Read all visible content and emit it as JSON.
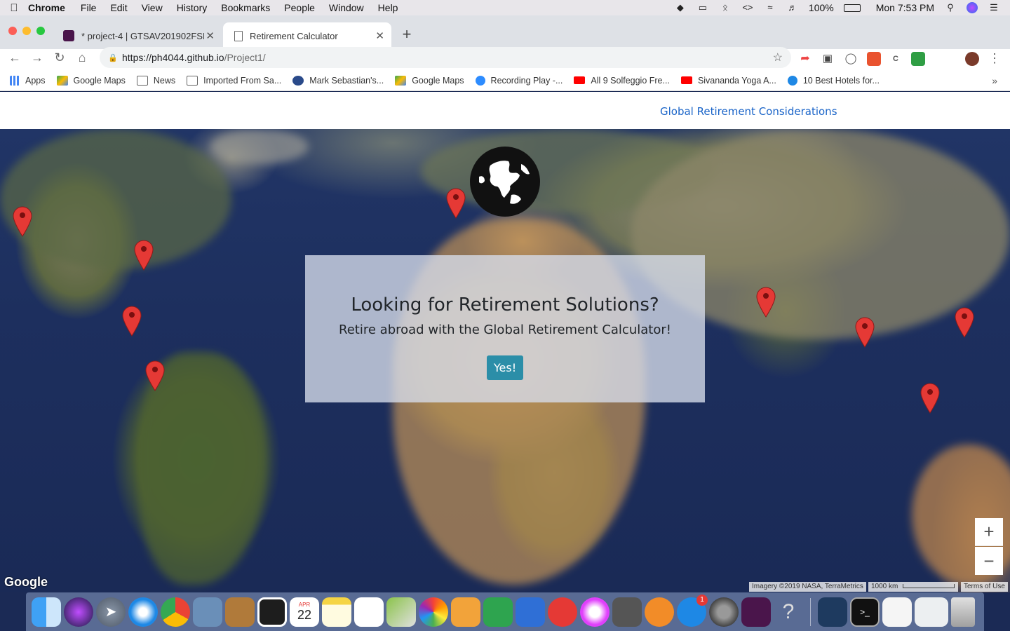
{
  "menubar": {
    "app": "Chrome",
    "items": [
      "File",
      "Edit",
      "View",
      "History",
      "Bookmarks",
      "People",
      "Window",
      "Help"
    ],
    "battery": "100%",
    "clock": "Mon 7:53 PM"
  },
  "tabs": [
    {
      "label": "* project-4 | GTSAV201902FSF",
      "active": false
    },
    {
      "label": "Retirement Calculator",
      "active": true
    }
  ],
  "address": {
    "host": "https://ph4044.github.io",
    "path": "/Project1/"
  },
  "bookmarks": [
    {
      "label": "Apps",
      "icon": "apps-grid-icon",
      "color": "#4285f4"
    },
    {
      "label": "Google Maps",
      "icon": "google-maps-icon",
      "color": "#34a853"
    },
    {
      "label": "News",
      "icon": "folder-icon",
      "color": "#777777"
    },
    {
      "label": "Imported From Sa...",
      "icon": "folder-icon",
      "color": "#777777"
    },
    {
      "label": "Mark Sebastian's...",
      "icon": "site-icon",
      "color": "#2a4a8a"
    },
    {
      "label": "Google Maps",
      "icon": "google-maps-icon",
      "color": "#34a853"
    },
    {
      "label": "Recording Play -...",
      "icon": "zoom-icon",
      "color": "#2d8cff"
    },
    {
      "label": "All 9 Solfeggio Fre...",
      "icon": "youtube-icon",
      "color": "#ff0000"
    },
    {
      "label": "Sivananda Yoga A...",
      "icon": "youtube-icon",
      "color": "#ff0000"
    },
    {
      "label": "10 Best Hotels for...",
      "icon": "site-icon",
      "color": "#1e88e5"
    }
  ],
  "page": {
    "nav_link": "Global Retirement Considerations",
    "heading": "Looking for Retirement Solutions?",
    "subheading": "Retire abroad with the Global Retirement Calculator!",
    "cta": "Yes!"
  },
  "map": {
    "zoom_in": "+",
    "zoom_out": "−",
    "logo": "Google",
    "imagery": "Imagery ©2019 NASA, TerraMetrics",
    "scale": "1000 km",
    "terms": "Terms of Use",
    "marker_count": 10
  },
  "dock": {
    "calendar_month": "APR",
    "calendar_day": "22",
    "appstore_badge": "1"
  }
}
